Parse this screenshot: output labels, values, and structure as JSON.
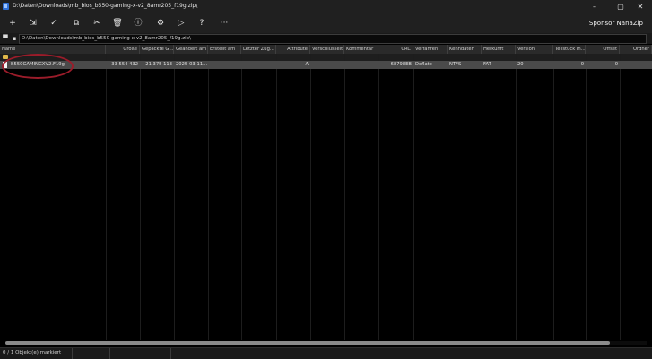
{
  "window": {
    "title": "D:\\Daten\\Downloads\\mb_bios_b550-gaming-x-v2_8amr205_f19g.zip\\",
    "minimize": "–",
    "maximize": "▢",
    "close": "✕"
  },
  "toolbar": {
    "add": "+",
    "extract": "⇲",
    "test": "✓",
    "copy": "⧉",
    "move": "✂",
    "delete": "🗑",
    "info": "ⓘ",
    "settings": "⚙",
    "run": "▷",
    "help": "?",
    "more": "···",
    "sponsor": "Sponsor NanaZip"
  },
  "address": {
    "path": "D:\\Daten\\Downloads\\mb_bios_b550-gaming-x-v2_8amr205_f19g.zip\\"
  },
  "columns": [
    "Name",
    "Größe",
    "Gepackte G...",
    "Geändert am",
    "Erstellt am",
    "Letzter Zug...",
    "Attribute",
    "Verschlüsselt",
    "Kommentar",
    "CRC",
    "Verfahren",
    "Kenndaten",
    "Herkunft",
    "Version",
    "Teilstück In...",
    "Offset",
    "Ordner"
  ],
  "rows": [
    {
      "name": "B550GAMINGXV2.F19g",
      "size": "33 554 432",
      "packed": "21 375 113",
      "modified": "2025-03-11...",
      "created": "",
      "accessed": "",
      "attributes": "A",
      "encrypted": "-",
      "comment": "",
      "crc": "68798EB",
      "method": "Deflate",
      "characteristics": "NTFS",
      "host_os": "FAT",
      "version": "20",
      "volume_index": "0",
      "offset": "0",
      "folder": ""
    }
  ],
  "status": {
    "selection": "0 / 1 Objekt(e) markiert",
    "size": "",
    "extra": ""
  },
  "colors": {
    "background": "#000000",
    "chrome": "#202020",
    "selected_row": "#4a4a4a",
    "annotation": "#9b1c2a"
  }
}
